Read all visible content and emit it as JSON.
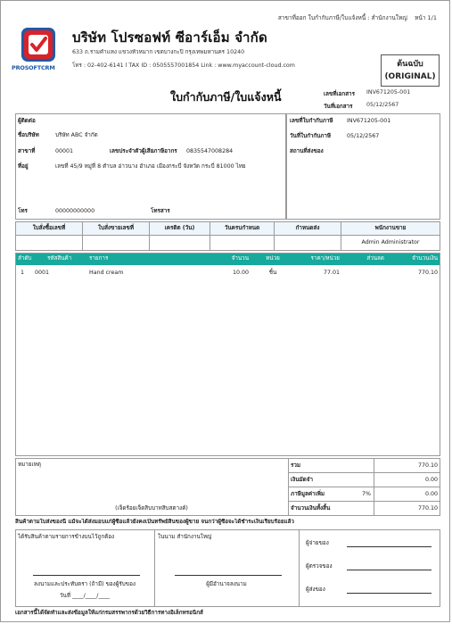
{
  "header": {
    "branch": "สาขาที่ออก ใบกำกับภาษี/ใบแจ้งหนี้ : สำนักงานใหญ่",
    "page": "หน้า 1/1"
  },
  "company": {
    "logo_text": "PROSOFTCRM",
    "name": "บริษัท โปรซอฟท์ ซีอาร์เอ็ม จำกัด",
    "address": "633 ถ.รามคำแหง แขวงหัวหมาก เขตบางกะปิ กรุงเทพมหานคร 10240",
    "contact": "โทร : 02-402-6141 l TAX ID : 0505557001854  Link : www.myaccount-cloud.com"
  },
  "original_badge": {
    "line1": "ต้นฉบับ",
    "line2": "(ORIGINAL)"
  },
  "doc": {
    "title": "ใบกำกับภาษี/ใบแจ้งหนี้",
    "no_label": "เลขที่เอกสาร",
    "no_value": "INV671205-001",
    "date_label": "วันที่เอกสาร",
    "date_value": "05/12/2567"
  },
  "customer": {
    "contact_label": "ผู้ติดต่อ",
    "company_label": "ชื่อบริษัท",
    "company_value": "บริษัท ABC จำกัด",
    "branch_label": "สาขาที่",
    "branch_value": "00001",
    "taxid_label": "เลขประจำตัวผู้เสียภาษีอากร",
    "taxid_value": "0835547008284",
    "address_label": "ที่อยู่",
    "address_value": "เลขที่ 45/9 หมู่ที่ 8 ตำบล อ่าวนาง อำเภอ เมืองกระบี่ จังหวัด กระบี่ 81000 ไทย",
    "phone_label": "โทร",
    "phone_value": "00000000000",
    "fax_label": "โทรสาร"
  },
  "invoice_ref": {
    "no_label": "เลขที่ใบกำกับภาษี",
    "no_value": "INV671205-001",
    "date_label": "วันที่ใบกำกับภาษี",
    "date_value": "05/12/2567",
    "ship_label": "สถานที่ส่งของ"
  },
  "order_table": {
    "headers": [
      "ใบสั่งซื้อเลขที่",
      "ใบสั่งขายเลขที่",
      "เครดิต (วัน)",
      "วันครบกำหนด",
      "กำหนดส่ง",
      "พนักงานขาย"
    ],
    "values": [
      "",
      "",
      "",
      "",
      "",
      "Admin Administrator"
    ]
  },
  "items_table": {
    "headers": [
      "ลำดับ",
      "รหัสสินค้า",
      "รายการ",
      "จำนวน",
      "หน่วย",
      "ราคา/หน่วย",
      "ส่วนลด",
      "จำนวนเงิน"
    ],
    "rows": [
      {
        "seq": "1",
        "code": "0001",
        "desc": "Hand cream",
        "qty": "10.00",
        "unit": "ชิ้น",
        "price": "77.01",
        "discount": "",
        "amount": "770.10"
      }
    ]
  },
  "summary": {
    "remark_label": "หมายเหตุ",
    "amount_words": "(เจ็ดร้อยเจ็ดสิบบาทสิบสตางค์)",
    "total_label": "รวม",
    "total_value": "770.10",
    "deposit_label": "เงินมัดจำ",
    "deposit_value": "0.00",
    "vat_label": "ภาษีมูลค่าเพิ่ม",
    "vat_rate": "7%",
    "vat_value": "0.00",
    "grand_label": "จำนวนเงินทั้งสิ้น",
    "grand_value": "770.10"
  },
  "notice": "สินค้าตามใบส่งของนี้ แม้จะได้ส่งมอบแก่ผู้ซื้อแล้วยังคงเป็นทรัพย์สินของผู้ขาย จนกว่าผู้ซื้อจะได้ชำระเงินเรียบร้อยแล้ว",
  "signatures": {
    "received_title": "ได้รับสินค้าตามรายการข้างบนไว้ถูกต้อง",
    "received_sign": "ลงนามและประทับตรา (ถ้ามี) ของผู้รับของ",
    "received_date": "วันที่ ____/____/____",
    "company_title": "ในนาม สำนักงานใหญ่",
    "company_sign": "ผู้มีอำนาจลงนาม",
    "payer_label": "ผู้จ่ายของ",
    "checker_label": "ผู้ตรวจของ",
    "sender_label": "ผู้ส่งของ"
  },
  "footer_note": "เอกสารนี้ได้จัดทำและส่งข้อมูลให้แก่กรมสรรพากรด้วยวิธีการทางอิเล็กทรอนิกส์",
  "colors": {
    "accent": "#16a99c",
    "logo_red": "#d8232a",
    "logo_blue": "#1f5aa6"
  }
}
